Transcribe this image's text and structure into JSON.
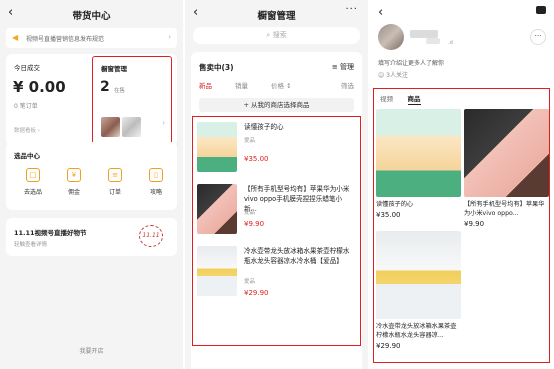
{
  "panel1": {
    "title": "带货中心",
    "notice": "视频号直播营销信息发布规范",
    "today_label": "今日成交",
    "today_amount": "¥ 0.00",
    "orders": "0 笔订单",
    "data_link": "数据看板 ›",
    "window_label": "橱窗管理",
    "window_count": "2",
    "window_unit": "在售",
    "tools_title": "选品中心",
    "tools": [
      {
        "label": "去选品",
        "icon": "cart-icon"
      },
      {
        "label": "佣金",
        "icon": "coin-icon"
      },
      {
        "label": "订单",
        "icon": "order-icon"
      },
      {
        "label": "攻略",
        "icon": "book-icon"
      }
    ],
    "promo_title": "11.11视频号直播好物节",
    "promo_sub": "轻触查看详情",
    "promo_logo": "11.11",
    "open_shop": "我要开店"
  },
  "panel2": {
    "title": "橱窗管理",
    "search_placeholder": "搜索",
    "onsale": "售卖中(3)",
    "manage": "管理",
    "filters": [
      "新品",
      "销量",
      "价格 ↕",
      "筛选"
    ],
    "from_shop": "+ 从我的商店选择商品",
    "products": [
      {
        "title": "读懂孩子的心",
        "shop": "爱品",
        "price": "¥35.00"
      },
      {
        "title": "【所有手机型号均有】苹果华为小米vivo oppo手机膜壳捏捏乐蜡笔小新...",
        "shop": "爱品",
        "price": "¥9.90"
      },
      {
        "title": "冷水壶带龙头放冰箱水果茶壶柠檬水瓶水龙头容器凉水冷水桶【爱品】",
        "shop": "爱品",
        "price": "¥29.90"
      }
    ]
  },
  "panel3": {
    "name_suffix": ".d",
    "intro": "填写介绍让更多人了解你",
    "follow": "3人关注",
    "tabs": [
      "视频",
      "商品"
    ],
    "items": [
      {
        "title": "读懂孩子的心",
        "price": "¥35.00"
      },
      {
        "title": "【所有手机型号均有】苹果华为小米vivo oppo...",
        "price": "¥9.90"
      },
      {
        "title": "冷水壶带龙头放冰箱水果茶壶柠檬水瓶水龙头容器凉...",
        "price": "¥29.90"
      }
    ]
  }
}
